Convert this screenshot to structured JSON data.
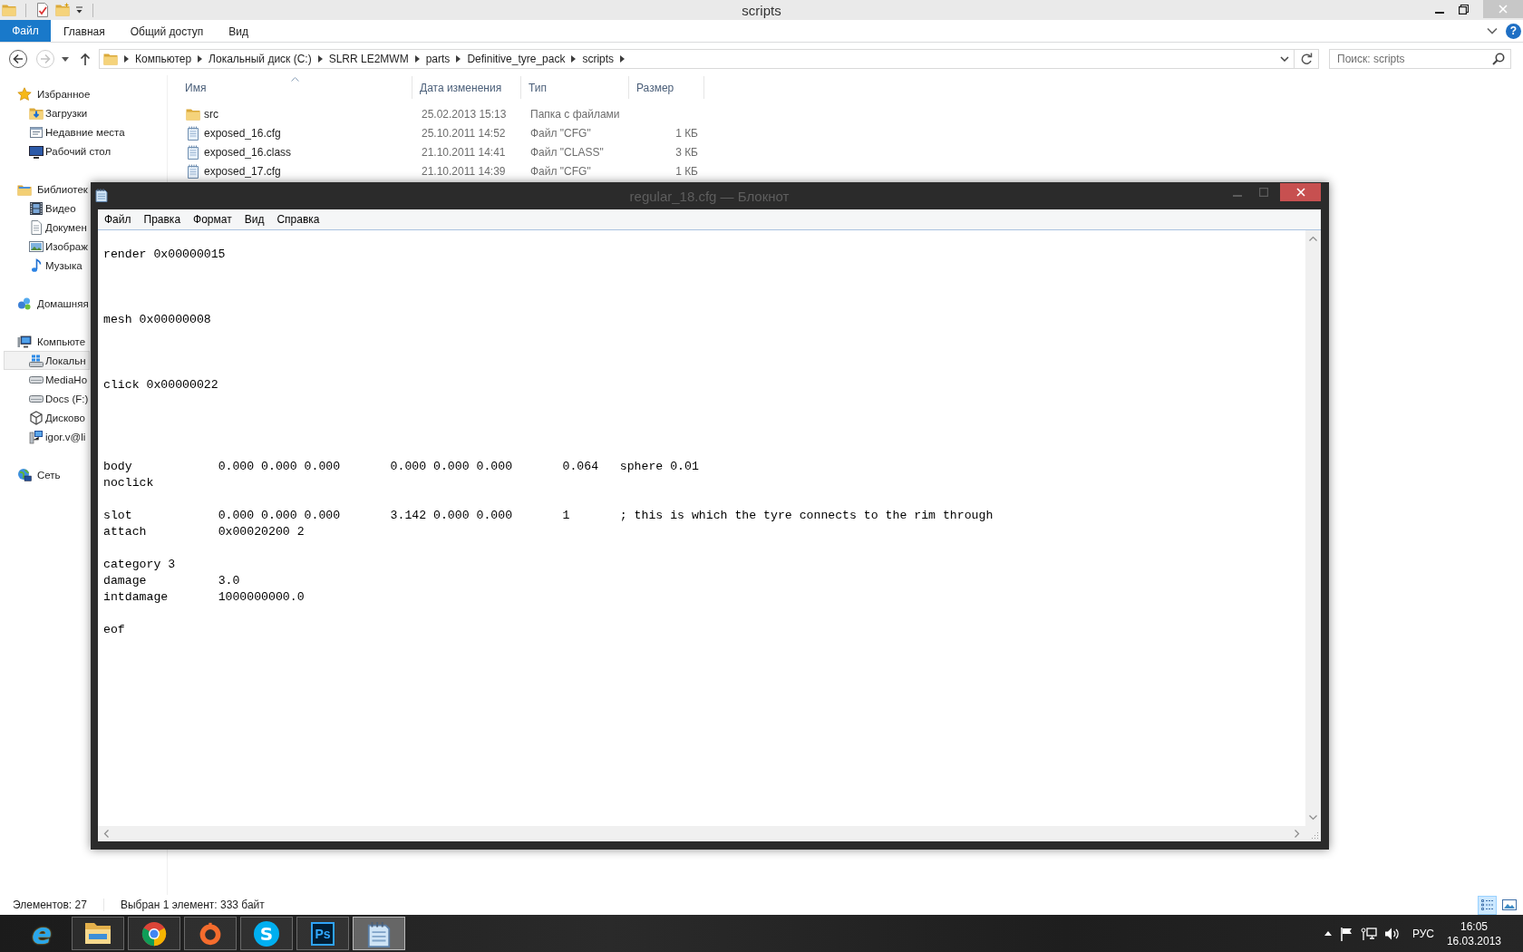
{
  "explorer": {
    "title": "scripts",
    "ribbon": {
      "file_tab": "Файл",
      "tabs": [
        {
          "label": "Главная",
          "selected": false
        },
        {
          "label": "Общий доступ",
          "selected": false
        },
        {
          "label": "Вид",
          "selected": false
        }
      ],
      "help": "?"
    },
    "address": {
      "back": {
        "disabled": false
      },
      "forward": {
        "disabled": true
      },
      "path": [
        "Компьютер",
        "Локальный диск (C:)",
        "SLRR LE2MWM",
        "parts",
        "Definitive_tyre_pack",
        "scripts"
      ]
    },
    "search": {
      "placeholder": "Поиск: scripts"
    },
    "navigation": [
      {
        "label": "Избранное",
        "selected": false,
        "children": [
          {
            "label": "Загрузки",
            "selected": false
          },
          {
            "label": "Недавние места",
            "selected": false
          },
          {
            "label": "Рабочий стол",
            "selected": false
          }
        ]
      },
      {
        "label": "Библиотек",
        "selected": false,
        "children": [
          {
            "label": "Видео",
            "selected": false
          },
          {
            "label": "Докумен",
            "selected": false
          },
          {
            "label": "Изображ",
            "selected": false
          },
          {
            "label": "Музыка",
            "selected": false
          }
        ]
      },
      {
        "label": "Домашняя",
        "selected": false
      },
      {
        "label": "Компьюте",
        "selected": false,
        "children": [
          {
            "label": "Локальн",
            "selected": true
          },
          {
            "label": "MediaHo",
            "selected": false
          },
          {
            "label": "Docs (F:)",
            "selected": false
          },
          {
            "label": "Дисково",
            "selected": false
          },
          {
            "label": "igor.v@li",
            "selected": false
          }
        ]
      },
      {
        "label": "Сеть",
        "selected": false
      }
    ],
    "file_list": {
      "columns": [
        {
          "label": "Имя",
          "sorted": true
        },
        {
          "label": "Дата изменения",
          "sorted": false
        },
        {
          "label": "Тип",
          "sorted": false
        },
        {
          "label": "Размер",
          "sorted": false
        }
      ],
      "rows": [
        {
          "kind": "folder",
          "name": "src",
          "date": "25.02.2013 15:13",
          "type": "Папка с файлами",
          "selected": false
        },
        {
          "kind": "file",
          "name": "exposed_16.cfg",
          "date": "25.10.2011 14:52",
          "type": "Файл \"CFG\"",
          "size": "1 КБ",
          "selected": false
        },
        {
          "kind": "file",
          "name": "exposed_16.class",
          "date": "21.10.2011 14:41",
          "type": "Файл \"CLASS\"",
          "size": "3 КБ",
          "selected": false
        },
        {
          "kind": "file",
          "name": "exposed_17.cfg",
          "date": "21.10.2011 14:39",
          "type": "Файл \"CFG\"",
          "size": "1 КБ",
          "selected": false
        }
      ]
    },
    "status_bar": {
      "items_count": "Элементов: 27",
      "selection": "Выбран 1 элемент: 333 байт",
      "views": [
        {
          "selected": true
        },
        {
          "selected": false
        }
      ]
    }
  },
  "notepad": {
    "title": "regular_18.cfg — Блокнот",
    "menu": [
      "Файл",
      "Правка",
      "Формат",
      "Вид",
      "Справка"
    ],
    "content": "\nrender 0x00000015\n\n\n\nmesh 0x00000008\n\n\n\nclick 0x00000022\n\n\n\n\nbody\t\t0.000 0.000 0.000\t0.000 0.000 0.000\t0.064\tsphere 0.01\nnoclick\n\nslot\t\t0.000 0.000 0.000\t3.142 0.000 0.000\t1\t; this is which the tyre connects to the rim through\nattach\t\t0x00020200 2\n\ncategory 3\ndamage\t\t3.0\nintdamage\t1000000000.0\n\neof"
  },
  "taskbar": {
    "apps": [
      {
        "kind": "e-logo",
        "glyph": "e",
        "running": false,
        "selected": false
      },
      {
        "kind": "folder",
        "running": true,
        "selected": false
      },
      {
        "kind": "wheel",
        "running": true,
        "selected": false
      },
      {
        "kind": "ring",
        "running": true,
        "selected": false
      },
      {
        "kind": "s-logo",
        "glyph": "S",
        "running": true,
        "selected": false
      },
      {
        "kind": "ps-logo",
        "glyph": "Ps",
        "running": true,
        "selected": false
      },
      {
        "kind": "notepad",
        "running": true,
        "selected": true
      }
    ],
    "tray": {
      "language": "РУС",
      "time": "16:05",
      "date": "16.03.2013"
    }
  }
}
